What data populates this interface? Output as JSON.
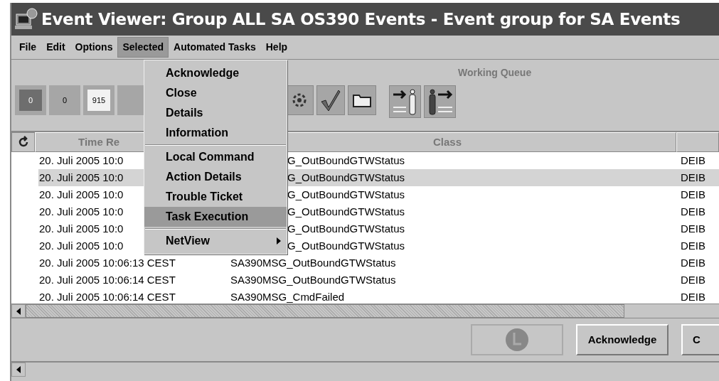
{
  "window": {
    "title": "Event Viewer: Group ALL SA OS390 Events - Event group for SA Events"
  },
  "menu_bar": [
    {
      "label": "File",
      "selected": false
    },
    {
      "label": "Edit",
      "selected": false
    },
    {
      "label": "Options",
      "selected": false
    },
    {
      "label": "Selected",
      "selected": true
    },
    {
      "label": "Automated Tasks",
      "selected": false
    },
    {
      "label": "Help",
      "selected": false
    }
  ],
  "dropdown_menu": {
    "groups": [
      [
        {
          "label": "Acknowledge",
          "selected": false,
          "submenu": false
        },
        {
          "label": "Close",
          "selected": false,
          "submenu": false
        },
        {
          "label": "Details",
          "selected": false,
          "submenu": false
        },
        {
          "label": "Information",
          "selected": false,
          "submenu": false
        }
      ],
      [
        {
          "label": "Local Command",
          "selected": false,
          "submenu": false
        },
        {
          "label": "Action Details",
          "selected": false,
          "submenu": false
        },
        {
          "label": "Trouble Ticket",
          "selected": false,
          "submenu": false
        },
        {
          "label": "Task Execution",
          "selected": true,
          "submenu": false
        }
      ],
      [
        {
          "label": "NetView",
          "selected": false,
          "submenu": true
        }
      ]
    ]
  },
  "toolbar": {
    "title": "Working Queue",
    "counters": [
      {
        "label": "0",
        "color": "#6e6e6e"
      },
      {
        "label": "0",
        "color": "#a6a6a6"
      },
      {
        "label": "915",
        "color": "#f2f2f2"
      },
      {
        "color": "#a6a6a6"
      }
    ]
  },
  "table": {
    "columns": [
      "Time Re",
      "Class",
      ""
    ],
    "rows": [
      {
        "covered": true,
        "selected": false,
        "cells": [
          "20. Juli 2005 10:0",
          "G_OutBoundGTWStatus",
          "DEIB"
        ]
      },
      {
        "covered": true,
        "selected": true,
        "cells": [
          "20. Juli 2005 10:0",
          "G_OutBoundGTWStatus",
          "DEIB"
        ]
      },
      {
        "covered": true,
        "selected": false,
        "cells": [
          "20. Juli 2005 10:0",
          "G_OutBoundGTWStatus",
          "DEIB"
        ]
      },
      {
        "covered": true,
        "selected": false,
        "cells": [
          "20. Juli 2005 10:0",
          "G_OutBoundGTWStatus",
          "DEIB"
        ]
      },
      {
        "covered": true,
        "selected": false,
        "cells": [
          "20. Juli 2005 10:0",
          "G_OutBoundGTWStatus",
          "DEIB"
        ]
      },
      {
        "covered": true,
        "selected": false,
        "cells": [
          "20. Juli 2005 10:0",
          "G_OutBoundGTWStatus",
          "DEIB"
        ]
      },
      {
        "covered": false,
        "selected": false,
        "cells": [
          "20. Juli 2005 10:06:13 CEST",
          "SA390MSG_OutBoundGTWStatus",
          "DEIB"
        ]
      },
      {
        "covered": false,
        "selected": false,
        "cells": [
          "20. Juli 2005 10:06:14 CEST",
          "SA390MSG_OutBoundGTWStatus",
          "DEIB"
        ]
      },
      {
        "covered": false,
        "selected": false,
        "cells": [
          "20. Juli 2005 10:06:14 CEST",
          "SA390MSG_CmdFailed",
          "DEIB"
        ]
      }
    ]
  },
  "buttons": [
    {
      "disabled": true
    },
    {
      "label": "Acknowledge",
      "disabled": false
    },
    {
      "label": "C",
      "disabled": false
    }
  ]
}
